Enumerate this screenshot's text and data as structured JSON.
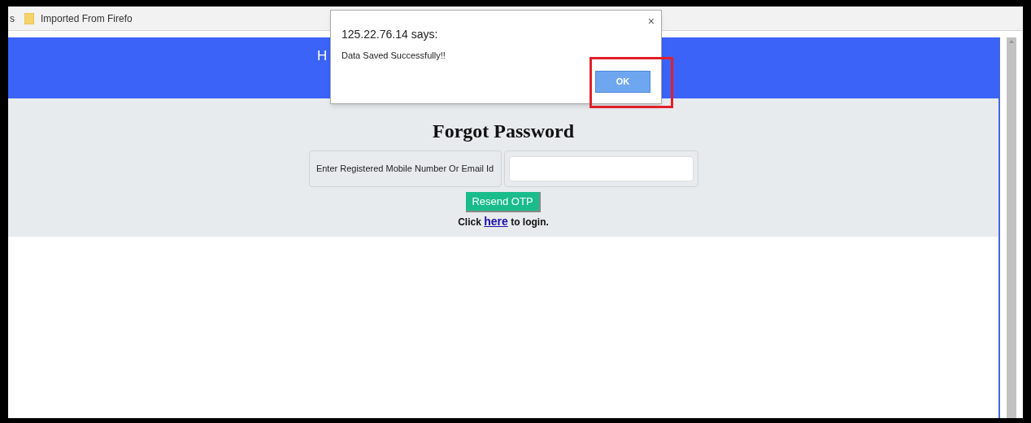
{
  "bookmarks_bar": {
    "items": [
      {
        "kind": "text",
        "label": "s"
      },
      {
        "kind": "folder",
        "label": "Imported From Firefo"
      }
    ]
  },
  "header": {
    "title": "H"
  },
  "form": {
    "title": "Forgot Password",
    "field_label": "Enter Registered Mobile Number Or Email Id",
    "button": "Resend OTP",
    "login_before": "Click",
    "login_link": "here",
    "login_after": "to login."
  },
  "dialog": {
    "title": "125.22.76.14 says:",
    "message": "Data Saved Successfully!!",
    "close": "×",
    "button": "OK",
    "highlighted": true
  }
}
